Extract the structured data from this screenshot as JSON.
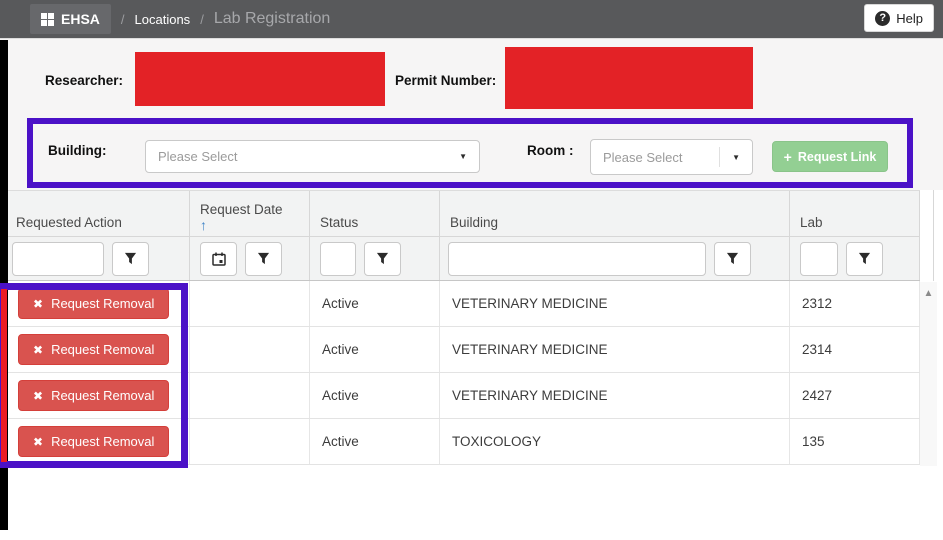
{
  "navbar": {
    "app_name": "EHSA",
    "separator": "/",
    "breadcrumb": [
      {
        "label": "Locations"
      },
      {
        "label": "Lab Registration"
      }
    ],
    "help": {
      "label": "Help",
      "icon": "?"
    }
  },
  "permit_form": {
    "researcher_label": "Researcher:",
    "permit_label": "Permit Number:",
    "researcher_value_redacted": true,
    "permit_value_redacted": true
  },
  "link_form": {
    "building_label": "Building:",
    "building_value": "Please Select",
    "room_label": "Room :",
    "room_value": "Please Select",
    "caret_icon": "▼",
    "request_link": {
      "plus_icon": "+",
      "label": "Request Link"
    }
  },
  "grid": {
    "columns": [
      {
        "label": "Requested Action"
      },
      {
        "label": "Request Date",
        "sorted": "ascending",
        "sort_icon": "↑"
      },
      {
        "label": "Status"
      },
      {
        "label": "Building"
      },
      {
        "label": "Lab"
      }
    ],
    "filters": {
      "requested_action_value": "",
      "status_value": "",
      "building_value": "",
      "lab_value": ""
    },
    "rows": [
      {
        "action_icon": "✖",
        "action": "Request Removal",
        "date": "",
        "status": "Active",
        "building": "VETERINARY MEDICINE",
        "lab": "2312"
      },
      {
        "action_icon": "✖",
        "action": "Request Removal",
        "date": "",
        "status": "Active",
        "building": "VETERINARY MEDICINE",
        "lab": "2314"
      },
      {
        "action_icon": "✖",
        "action": "Request Removal",
        "date": "",
        "status": "Active",
        "building": "VETERINARY MEDICINE",
        "lab": "2427"
      },
      {
        "action_icon": "✖",
        "action": "Request Removal",
        "date": "",
        "status": "Active",
        "building": "TOXICOLOGY",
        "lab": "135"
      }
    ],
    "scroll_up_icon": "▲"
  },
  "colors": {
    "redaction": "#e32226",
    "annotation_purple": "#4b11c7",
    "annotation_red": "#ec1c24",
    "removal_button": "#d9534f",
    "request_link_button": "#93cf93",
    "sort_arrow": "#4285c8"
  }
}
